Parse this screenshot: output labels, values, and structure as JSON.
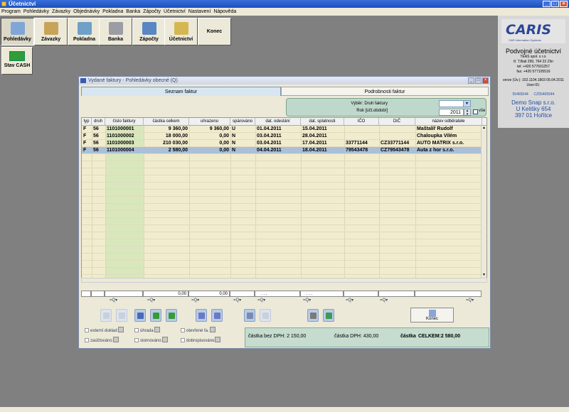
{
  "app": {
    "title": "Účetnictví"
  },
  "menu": [
    "Program",
    "Pohledávky",
    "Závazky",
    "Objednávky",
    "Pokladna",
    "Banka",
    "Zápočty",
    "Účetnictví",
    "Nastavení",
    "Nápověda"
  ],
  "toolbar": {
    "pohledavky": "Pohledávky",
    "zavazky": "Závazky",
    "pokladna": "Pokladna",
    "banka": "Banka",
    "zapocty": "Zápočty",
    "ucetnictvi": "Účetnictví",
    "konec": "Konec",
    "stav_cash": "Stav CASH"
  },
  "panel": {
    "logo_text": "CARIS",
    "logo_sub": "CAR Information Systems",
    "title": "Podvojné účetnictví",
    "company": "TEAS spol. s r.o.",
    "address": "tř. T.Bati 299, 764 22 Zlín",
    "tel": "tel: +420 577601257",
    "fax": "fax: +420 577105516",
    "version": "verze (Úv.): 102.1104.1803 05.04.2011",
    "user": "User:01:",
    "ico": "55465544",
    "dic": "CZ55465544",
    "demo_name": "Demo Snap s.r.o.",
    "demo_street": "U Kelišky 654",
    "demo_city": "397 01 Hořitce"
  },
  "dialog": {
    "title": "Vydané faktury - Pohledávky obecné (Q)",
    "tab_list": "Seznam faktur",
    "tab_detail": "Podrobnosti faktur",
    "filter_label": "Výběr: Druh faktury",
    "year_label": "Rok [účt.období]",
    "year_value": "2011",
    "all_label": "vše"
  },
  "table": {
    "columns": [
      "typ",
      "druh",
      "číslo faktury",
      "částka celkem",
      "uhrazeno",
      "spárováno",
      "dat. odeslání",
      "dat. splatnosti",
      "IČO",
      "DIČ",
      "název odběratele"
    ],
    "rows": [
      {
        "typ": "F",
        "druh": "56",
        "cislo": "1101000001",
        "castka": "9 360,00",
        "uhrazeno": "9 360,00",
        "sparovano": "U",
        "odeslani": "01.04.2011",
        "splatnost": "15.04.2011",
        "ico": "",
        "dic": "",
        "nazev": "Maštalíř Rudolf"
      },
      {
        "typ": "F",
        "druh": "56",
        "cislo": "1101000002",
        "castka": "18 000,00",
        "uhrazeno": "0,00",
        "sparovano": "N",
        "odeslani": "03.04.2011",
        "splatnost": "28.04.2011",
        "ico": "",
        "dic": "",
        "nazev": "Chaloupka Vilém"
      },
      {
        "typ": "F",
        "druh": "56",
        "cislo": "1101000003",
        "castka": "210 030,00",
        "uhrazeno": "0,00",
        "sparovano": "N",
        "odeslani": "03.04.2011",
        "splatnost": "17.04.2011",
        "ico": "33771144",
        "dic": "CZ33771144",
        "nazev": "AUTO MATRIX s.r.o."
      },
      {
        "typ": "F",
        "druh": "56",
        "cislo": "1101000004",
        "castka": "2 580,00",
        "uhrazeno": "0,00",
        "sparovano": "N",
        "odeslani": "04.04.2011",
        "splatnost": "18.04.2011",
        "ico": "79543478",
        "dic": "CZ79543478",
        "nazev": "Auta z hor s.r.o."
      }
    ],
    "selected_index": 3,
    "sum_castka": "0,00",
    "sum_uhrazeno": "0,00",
    "date_placeholder": ". . ."
  },
  "actions": {
    "konec": "Konec"
  },
  "checks": {
    "externi": "externí doklad",
    "zauctovano": "zaúčtováno",
    "uhrada": "úhrada",
    "stornovano": "stornováno",
    "otevrene": "otevřené fa.",
    "dobropisy": "dobropisováno"
  },
  "totals": {
    "bez_dph": "částka bez DPH: 2 150,00",
    "dph": "částka DPH: 430,00",
    "celkem_label": "částka",
    "celkem": "CELKEM:2 580,00"
  }
}
